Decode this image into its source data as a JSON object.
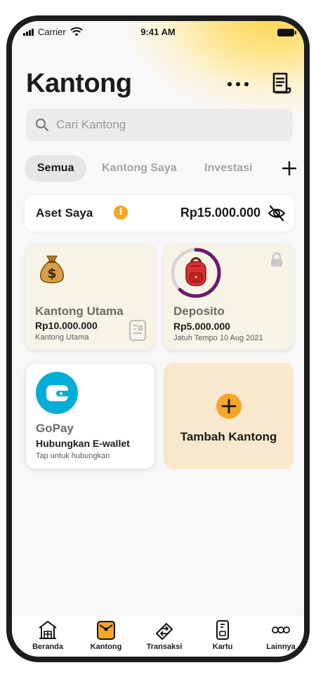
{
  "status_bar": {
    "carrier": "Carrier",
    "time": "9:41 AM"
  },
  "header": {
    "title": "Kantong"
  },
  "search": {
    "placeholder": "Cari Kantong"
  },
  "tabs": [
    {
      "label": "Semua",
      "active": true
    },
    {
      "label": "Kantong Saya",
      "active": false
    },
    {
      "label": "Investasi",
      "active": false
    }
  ],
  "asset": {
    "label": "Aset Saya",
    "amount": "Rp15.000.000"
  },
  "pockets": {
    "utama": {
      "name": "Kantong Utama",
      "balance": "Rp10.000.000",
      "subtitle": "Kantong Utama"
    },
    "deposito": {
      "name": "Deposito",
      "balance": "Rp5.000.000",
      "subtitle": "Jatuh Tempo  10 Aug 2021",
      "progress": 0.62
    },
    "gopay": {
      "name": "GoPay",
      "action": "Hubungkan E-wallet",
      "subtitle": "Tap untuk hubungkan"
    },
    "add": {
      "label": "Tambah Kantong"
    }
  },
  "bottom_nav": [
    {
      "label": "Beranda",
      "icon": "home-icon"
    },
    {
      "label": "Kantong",
      "icon": "wallet-icon",
      "active": true
    },
    {
      "label": "Transaksi",
      "icon": "transfer-icon"
    },
    {
      "label": "Kartu",
      "icon": "card-icon"
    },
    {
      "label": "Lainnya",
      "icon": "more-icon"
    }
  ],
  "colors": {
    "accent": "#f5a623",
    "progress": "#6b1a6b",
    "gopay": "#00aed6",
    "pocket_bg": "#f6f3e7",
    "add_bg": "#f9e8cd"
  }
}
